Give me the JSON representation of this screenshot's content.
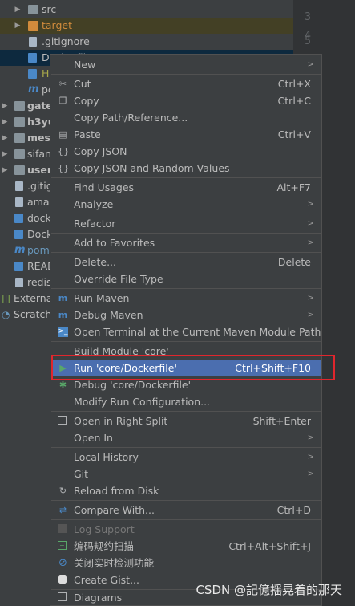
{
  "tree": {
    "items": [
      {
        "label": "src",
        "icon": "folder-icon"
      },
      {
        "label": "target",
        "icon": "folder-icon"
      },
      {
        "label": ".gitignore",
        "icon": "file-icon"
      },
      {
        "label": "Dockerfile",
        "icon": "docker-file-icon"
      },
      {
        "label": "HE",
        "icon": "markdown-file-icon"
      },
      {
        "label": "pc",
        "icon": "maven-file-icon"
      },
      {
        "label": "gatew",
        "icon": "module-folder-icon"
      },
      {
        "label": "h3yun",
        "icon": "module-folder-icon"
      },
      {
        "label": "messa",
        "icon": "module-folder-icon"
      },
      {
        "label": "sifan-",
        "icon": "module-folder-icon"
      },
      {
        "label": "user-",
        "icon": "module-folder-icon"
      },
      {
        "label": ".gitig",
        "icon": "file-icon"
      },
      {
        "label": "amaz",
        "icon": "file-icon"
      },
      {
        "label": "docke",
        "icon": "docker-file-icon"
      },
      {
        "label": "Docke",
        "icon": "docker-file-icon"
      },
      {
        "label": "pom.x",
        "icon": "maven-file-icon"
      },
      {
        "label": "READ",
        "icon": "markdown-file-icon"
      },
      {
        "label": "redis.",
        "icon": "file-icon"
      },
      {
        "label": "External",
        "icon": "library-icon"
      },
      {
        "label": "Scratche",
        "icon": "scratches-icon"
      }
    ]
  },
  "gutter": {
    "lines": [
      "3",
      "4",
      "5"
    ]
  },
  "menu": {
    "new": "New",
    "cut": "Cut",
    "cut_sc": "Ctrl+X",
    "copy": "Copy",
    "copy_sc": "Ctrl+C",
    "copy_path": "Copy Path/Reference...",
    "paste": "Paste",
    "paste_sc": "Ctrl+V",
    "copy_json": "Copy JSON",
    "copy_json_random": "Copy JSON and Random Values",
    "find_usages": "Find Usages",
    "find_usages_sc": "Alt+F7",
    "analyze": "Analyze",
    "refactor": "Refactor",
    "add_favorites": "Add to Favorites",
    "delete": "Delete...",
    "delete_sc": "Delete",
    "override_type": "Override File Type",
    "run_maven": "Run Maven",
    "debug_maven": "Debug Maven",
    "open_terminal": "Open Terminal at the Current Maven Module Path",
    "build_module": "Build Module 'core'",
    "run_docker": "Run 'core/Dockerfile'",
    "run_docker_sc": "Ctrl+Shift+F10",
    "debug_docker": "Debug 'core/Dockerfile'",
    "modify_run": "Modify Run Configuration...",
    "open_right": "Open in Right Split",
    "open_right_sc": "Shift+Enter",
    "open_in": "Open In",
    "local_history": "Local History",
    "git": "Git",
    "reload_disk": "Reload from Disk",
    "compare_with": "Compare With...",
    "compare_with_sc": "Ctrl+D",
    "log_support": "Log Support",
    "code_scan": "编码规约扫描",
    "code_scan_sc": "Ctrl+Alt+Shift+J",
    "close_realtime": "关闭实时检测功能",
    "create_gist": "Create Gist...",
    "diagrams": "Diagrams"
  },
  "watermark": "CSDN @記億揺晃着的那天",
  "colors": {
    "highlight": "#4b6eaf",
    "annotation": "#e0262d",
    "menu_bg": "#3c3f41"
  }
}
